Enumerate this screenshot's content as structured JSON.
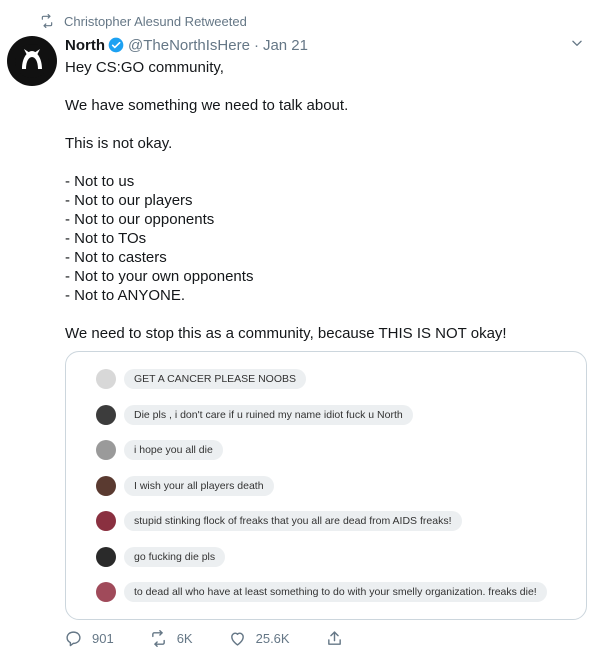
{
  "retweet_banner": {
    "icon": "retweet-icon",
    "text": "Christopher Alesund Retweeted"
  },
  "tweet": {
    "author_name": "North",
    "verified": true,
    "handle": "@TheNorthIsHere",
    "separator": "·",
    "date": "Jan 21",
    "text": "Hey CS:GO community,\n\nWe have something we need to talk about.\n\nThis is not okay.\n\n- Not to us\n- Not to our players\n- Not to our opponents\n- Not to TOs\n- Not to casters\n- Not to your own opponents\n- Not to ANYONE.\n\nWe need to stop this as a community, because THIS IS NOT okay!"
  },
  "media": {
    "messages": [
      {
        "text": "GET A CANCER PLEASE NOOBS",
        "avatar_color": "#d8d8d8"
      },
      {
        "text": "Die pls , i don't care if u ruined my name idiot fuck u North",
        "avatar_color": "#3c3c3c"
      },
      {
        "text": "i hope you all die",
        "avatar_color": "#9a9a9a"
      },
      {
        "text": "I wish your all players death",
        "avatar_color": "#5a3a30"
      },
      {
        "text": "stupid stinking flock of freaks that you all are dead from AIDS freaks!",
        "avatar_color": "#8a3040"
      },
      {
        "text": "go fucking die pls",
        "avatar_color": "#2a2a2a"
      },
      {
        "text": "to dead all who have at least something to do with your smelly organization. freaks die!",
        "avatar_color": "#a04a5a"
      }
    ]
  },
  "actions": {
    "reply_count": "901",
    "retweet_count": "6K",
    "like_count": "25.6K"
  },
  "colors": {
    "text": "#14171a",
    "muted": "#657786",
    "verified": "#1da1f2",
    "border": "#ccd6dd"
  }
}
